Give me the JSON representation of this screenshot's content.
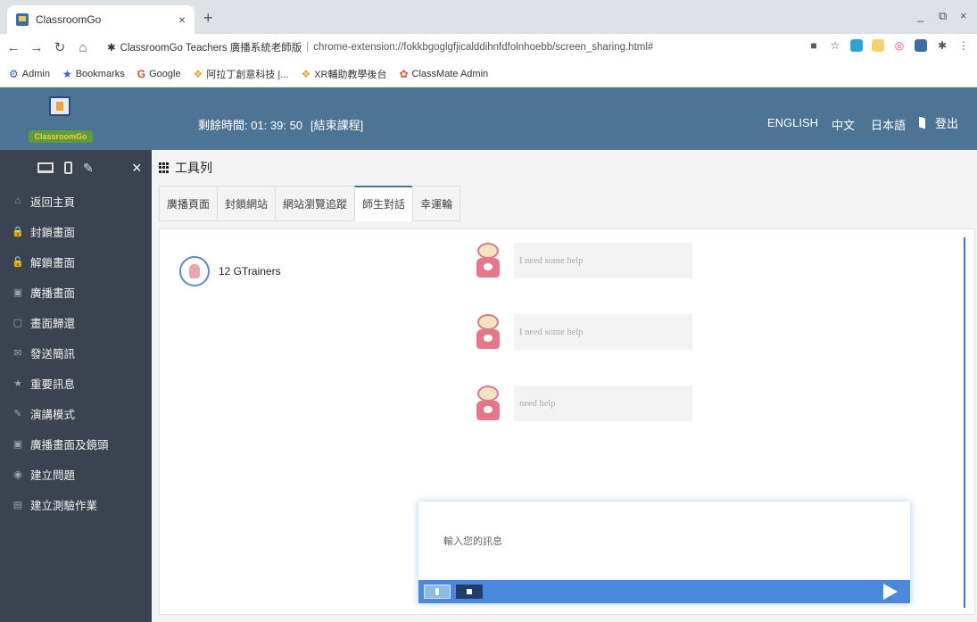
{
  "browser": {
    "tab_title": "ClassroomGo",
    "tab_close": "×",
    "new_tab": "+",
    "window_controls": [
      "_",
      "⧉",
      "×"
    ],
    "site_name": "ClassroomGo Teachers 廣播系統老師版",
    "url": "chrome-extension://fokkbgoglgfjicalddihnfdfolnhoebb/screen_sharing.html#",
    "bookmarks": [
      {
        "label": "Admin",
        "icon": "admin-icon"
      },
      {
        "label": "Bookmarks",
        "icon": "star-icon"
      },
      {
        "label": "Google",
        "icon": "google-icon"
      },
      {
        "label": "阿拉丁創意科技 |...",
        "icon": "aladdin-icon"
      },
      {
        "label": "XR輔助教學後台",
        "icon": "xr-icon"
      },
      {
        "label": "ClassMate Admin",
        "icon": "classmate-icon"
      }
    ]
  },
  "header": {
    "logo_text": "ClassroomGo",
    "timer": "剩餘時間: 01: 39: 50",
    "end_class": "[結束課程]",
    "languages": [
      "ENGLISH",
      "中文",
      "日本語"
    ],
    "logout": "登出"
  },
  "sidebar": {
    "close": "×",
    "items": [
      {
        "label": "返回主頁",
        "icon": "home-icon",
        "glyph": "⌂"
      },
      {
        "label": "封鎖畫面",
        "icon": "lock-icon",
        "glyph": "🔒"
      },
      {
        "label": "解鎖畫面",
        "icon": "unlock-icon",
        "glyph": "🔓"
      },
      {
        "label": "廣播畫面",
        "icon": "broadcast-icon",
        "glyph": "▣"
      },
      {
        "label": "畫面歸還",
        "icon": "monitor-icon",
        "glyph": "▢"
      },
      {
        "label": "發送簡訊",
        "icon": "message-icon",
        "glyph": "✉"
      },
      {
        "label": "重要訊息",
        "icon": "star-icon",
        "glyph": "★"
      },
      {
        "label": "演講模式",
        "icon": "pen-icon",
        "glyph": "✎"
      },
      {
        "label": "廣播畫面及鏡頭",
        "icon": "camera-icon",
        "glyph": "▣"
      },
      {
        "label": "建立問題",
        "icon": "question-icon",
        "glyph": "◉"
      },
      {
        "label": "建立測驗作業",
        "icon": "quiz-icon",
        "glyph": "▤"
      }
    ]
  },
  "content": {
    "toolbar_title": "工具列",
    "tabs": [
      {
        "label": "廣播頁面",
        "active": false
      },
      {
        "label": "封鎖網站",
        "active": false
      },
      {
        "label": "網站瀏覽追蹤",
        "active": false
      },
      {
        "label": "師生對話",
        "active": true
      },
      {
        "label": "幸運輪",
        "active": false
      }
    ],
    "student_name": "12 GTrainers",
    "messages": [
      {
        "text": "I need some help"
      },
      {
        "text": "I need some help"
      },
      {
        "text": "need help"
      }
    ],
    "composer_placeholder": "輸入您的訊息"
  },
  "colors": {
    "header_bg": "#4d7494",
    "sidebar_bg": "#3c4350",
    "composer_bar": "#4a89dc",
    "accent_blue": "#3f74b8"
  }
}
